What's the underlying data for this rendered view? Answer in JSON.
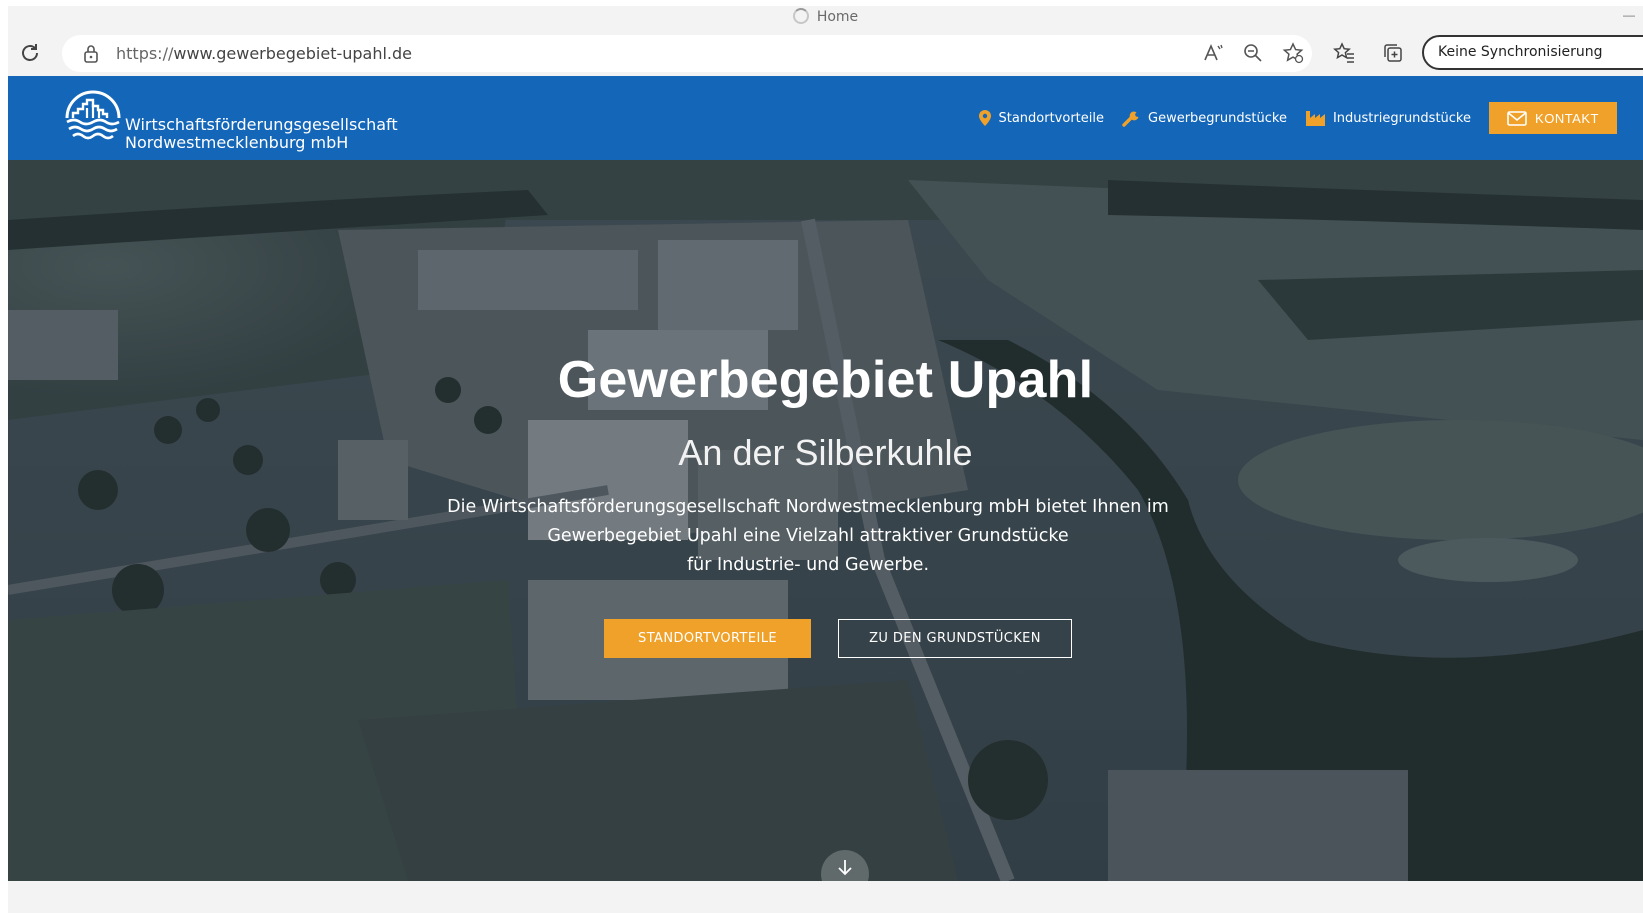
{
  "browser": {
    "tab_title": "Home",
    "url_protocol": "https://",
    "url_host": "www.gewerbegebiet-upahl.de",
    "sync_label": "Keine Synchronisierung"
  },
  "header": {
    "company_line1": "Wirtschaftsförderungsgesellschaft",
    "company_line2": "Nordwestmecklenburg mbH",
    "nav": [
      {
        "label": "Standortvorteile",
        "icon": "map-pin-icon"
      },
      {
        "label": "Gewerbegrundstücke",
        "icon": "wrench-icon"
      },
      {
        "label": "Industriegrundstücke",
        "icon": "factory-icon"
      }
    ],
    "contact_label": "KONTAKT"
  },
  "hero": {
    "title": "Gewerbegebiet Upahl",
    "subtitle": "An der Silberkuhle",
    "text_line1": "Die Wirtschaftsförderungsgesellschaft Nordwestmecklenburg mbH bietet Ihnen im",
    "text_line2": "Gewerbegebiet Upahl eine Vielzahl attraktiver Grundstücke",
    "text_line3": "für Industrie- und Gewerbe.",
    "primary_button": "STANDORTVORTEILE",
    "secondary_button": "ZU DEN GRUNDSTÜCKEN"
  },
  "colors": {
    "header_blue": "#1466b9",
    "accent_orange": "#f0a129",
    "hero_overlay": "#192634"
  }
}
